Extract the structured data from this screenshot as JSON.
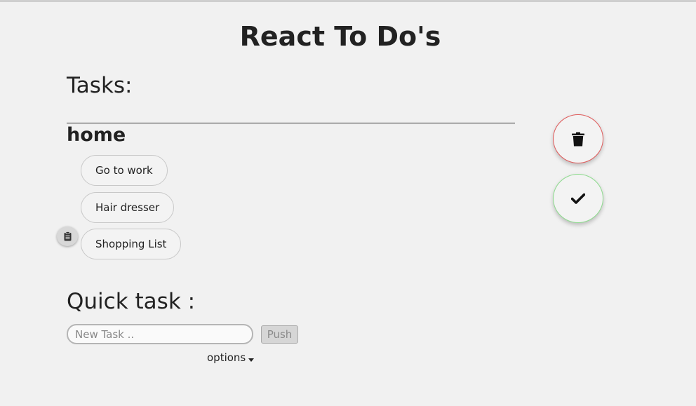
{
  "app": {
    "title": "React To Do's"
  },
  "tasks_section": {
    "heading": "Tasks:",
    "category": "home",
    "items": [
      {
        "label": "Go to work"
      },
      {
        "label": "Hair dresser"
      },
      {
        "label": "Shopping List"
      }
    ]
  },
  "actions": {
    "delete_icon": "trash-icon",
    "done_icon": "check-icon",
    "clipboard_icon": "clipboard-icon",
    "delete_border_color": "#e05c5c",
    "done_border_color": "#8fdc8f"
  },
  "quick_task": {
    "heading": "Quick task :",
    "input_placeholder": "New Task ..",
    "input_value": "",
    "push_label": "Push",
    "options_label": "options"
  }
}
